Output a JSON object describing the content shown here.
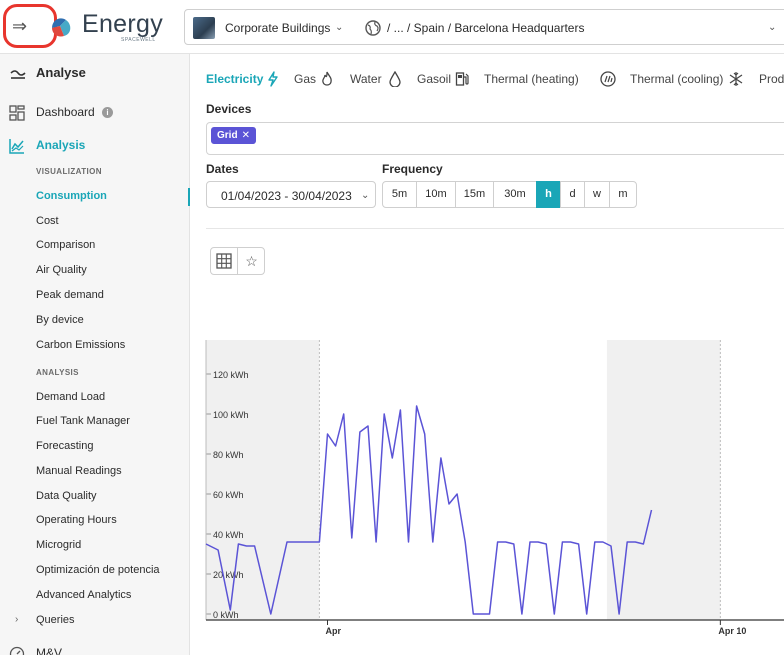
{
  "header": {
    "logo_text": "Energy",
    "logo_sub": "SPACEWELL",
    "building": "Corporate Buildings",
    "location": "/ ... / Spain / Barcelona Headquarters"
  },
  "sidebar": {
    "section_title": "Analyse",
    "dashboard": "Dashboard",
    "analysis": "Analysis",
    "visualization_heading": "VISUALIZATION",
    "visualization_items": [
      "Consumption",
      "Cost",
      "Comparison",
      "Air Quality",
      "Peak demand",
      "By device",
      "Carbon Emissions"
    ],
    "analysis_heading": "ANALYSIS",
    "analysis_items": [
      "Demand Load",
      "Fuel Tank Manager",
      "Forecasting",
      "Manual Readings",
      "Data Quality",
      "Operating Hours",
      "Microgrid",
      "Optimización de potencia",
      "Advanced Analytics"
    ],
    "queries": "Queries",
    "mv": "M&V"
  },
  "tabs": [
    "Electricity",
    "Gas",
    "Water",
    "Gasoil",
    "Thermal (heating)",
    "Thermal (cooling)",
    "Produce"
  ],
  "devices": {
    "label": "Devices",
    "chips": [
      "Grid"
    ]
  },
  "dates": {
    "label": "Dates",
    "value": "01/04/2023 - 30/04/2023"
  },
  "frequency": {
    "label": "Frequency",
    "options": [
      "5m",
      "10m",
      "15m",
      "30m",
      "h",
      "d",
      "w",
      "m"
    ],
    "selected": "h"
  },
  "chart_data": {
    "type": "line",
    "ylabel_ticks": [
      "0 kWh",
      "20 kWh",
      "40 kWh",
      "60 kWh",
      "80 kWh",
      "100 kWh",
      "120 kWh"
    ],
    "ylim": [
      0,
      120
    ],
    "x_ticks": [
      "Apr",
      "Apr 10"
    ],
    "series": [
      {
        "color": "#5b54d6",
        "x_days_from_mar30": [
          0,
          0.3,
          0.6,
          0.8,
          1.0,
          1.2,
          1.6,
          2.0,
          2.4,
          2.8,
          3.0,
          3.2,
          3.4,
          3.6,
          3.8,
          4.0,
          4.2,
          4.4,
          4.6,
          4.8,
          5.0,
          5.2,
          5.4,
          5.6,
          5.8,
          6.0,
          6.2,
          6.4,
          6.6,
          6.8,
          7.0,
          7.2,
          7.4,
          7.6,
          7.8,
          8.0,
          8.2,
          8.4,
          8.6,
          8.8,
          9.0,
          9.2,
          9.4,
          9.6,
          9.8,
          10.0,
          10.2,
          10.4,
          10.6,
          10.8,
          11.0
        ],
        "values": [
          35,
          32,
          2,
          35,
          34,
          34,
          0,
          36,
          36,
          36,
          90,
          84,
          100,
          38,
          91,
          94,
          36,
          100,
          78,
          102,
          36,
          104,
          90,
          36,
          78,
          55,
          60,
          36,
          0,
          0,
          0,
          36,
          36,
          35,
          0,
          36,
          36,
          35,
          0,
          36,
          36,
          35,
          0,
          36,
          36,
          34,
          0,
          36,
          36,
          35,
          52
        ]
      }
    ],
    "shaded_ranges_days_from_mar30": [
      [
        0,
        2.8
      ],
      [
        9.9,
        12.7
      ]
    ]
  }
}
